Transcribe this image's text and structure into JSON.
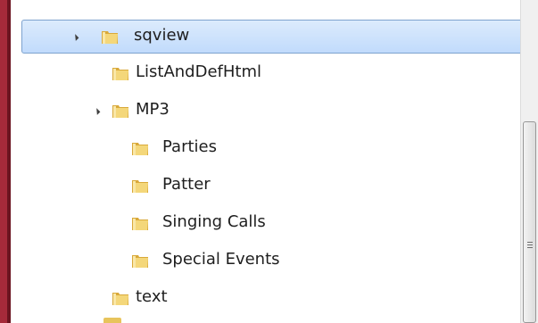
{
  "tree": {
    "items": [
      {
        "label": "sqview",
        "expanded": true,
        "selected": true,
        "icon": "folder-icon"
      },
      {
        "label": "ListAndDefHtml",
        "icon": "folder-icon"
      },
      {
        "label": "MP3",
        "expanded": true,
        "icon": "folder-icon"
      },
      {
        "label": "Parties",
        "icon": "folder-icon"
      },
      {
        "label": "Patter",
        "icon": "folder-icon"
      },
      {
        "label": "Singing Calls",
        "icon": "folder-icon"
      },
      {
        "label": "Special Events",
        "icon": "folder-icon"
      },
      {
        "label": "text",
        "icon": "folder-icon"
      }
    ]
  },
  "colors": {
    "selection_border": "#7da2ce",
    "selection_fill": "#c1dbfc",
    "folder_body": "#e8c45c",
    "window_frame": "#a52a3a"
  }
}
